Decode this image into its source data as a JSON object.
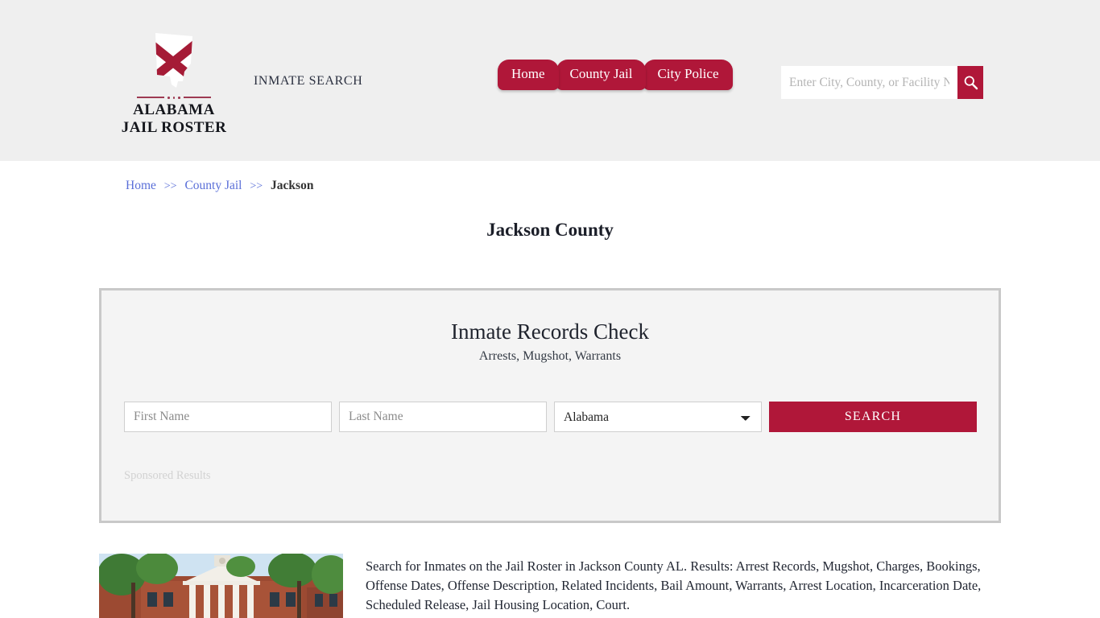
{
  "header": {
    "brand": {
      "line1": "ALABAMA",
      "line2": "JAIL ROSTER",
      "logo_icon": "alabama-state-flag-icon"
    },
    "tagline": "INMATE SEARCH",
    "nav": [
      {
        "label": "Home",
        "name": "nav-tab-home"
      },
      {
        "label": "County Jail",
        "name": "nav-tab-county-jail"
      },
      {
        "label": "City Police",
        "name": "nav-tab-city-police"
      }
    ],
    "search": {
      "placeholder": "Enter City, County, or Facility Name",
      "value": "",
      "button_icon": "search-icon"
    }
  },
  "breadcrumb": {
    "items": [
      {
        "label": "Home",
        "link": true
      },
      {
        "label": "County Jail",
        "link": true
      },
      {
        "label": "Jackson",
        "link": false
      }
    ],
    "separator": ">>"
  },
  "page": {
    "title": "Jackson County"
  },
  "panel": {
    "title": "Inmate Records Check",
    "subtitle": "Arrests, Mugshot, Warrants",
    "form": {
      "first_name_placeholder": "First Name",
      "first_name_value": "",
      "last_name_placeholder": "Last Name",
      "last_name_value": "",
      "state_selected": "Alabama",
      "state_options": [
        "Alabama"
      ],
      "submit_label": "SEARCH"
    },
    "sponsored_label": "Sponsored Results"
  },
  "content": {
    "thumbnail_alt": "jackson-county-courthouse-photo",
    "description": "Search for Inmates on the Jail Roster in Jackson County AL. Results: Arrest Records, Mugshot, Charges, Bookings, Offense Dates, Offense Description, Related Incidents, Bail Amount, Warrants, Arrest Location, Incarceration Date, Scheduled Release, Jail Housing Location, Court."
  },
  "colors": {
    "crimson": "#b01739",
    "header_bg": "#efefef",
    "panel_bg": "#f4f4f4",
    "panel_border": "#c9c9c9",
    "link_blue": "#5a6fd8"
  }
}
